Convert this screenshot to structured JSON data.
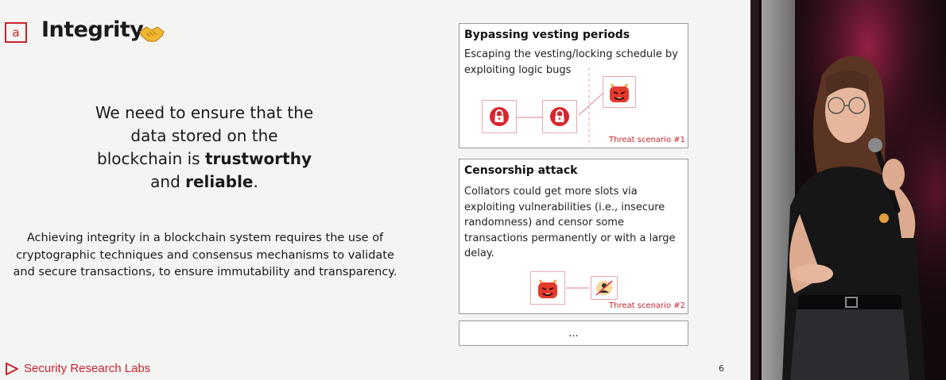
{
  "slide": {
    "badge": "a",
    "title": "Integrity",
    "headline_line1": "We need to ensure that the",
    "headline_line2": "data stored on the",
    "headline_line3_pre": "blockchain is ",
    "headline_line3_bold": "trustworthy",
    "headline_line4_pre": "and ",
    "headline_line4_bold": "reliable",
    "headline_line4_post": ".",
    "body": "Achieving integrity in a blockchain system requires the use of cryptographic techniques and consensus mechanisms to validate and secure transactions, to ensure immutability and transparency.",
    "footer_brand": "Security Research Labs",
    "page_number": "6",
    "cards": [
      {
        "title": "Bypassing vesting periods",
        "description_line1": "Escaping the vesting/locking schedule by",
        "description_line2": "exploiting logic bugs",
        "scenario": "Threat scenario #1"
      },
      {
        "title": "Censorship attack",
        "description_line1": "Collators could get more slots via",
        "description_line2": "exploiting vulnerabilities (i.e., insecure",
        "description_line3": "randomness) and censor some",
        "description_line4": "transactions permanently or with a large",
        "description_line5": "delay.",
        "scenario": "Threat scenario #2"
      },
      {
        "title": "..."
      }
    ]
  },
  "colors": {
    "brand_red": "#c8242f",
    "slide_bg": "#f4f4f2",
    "icon_border": "#e8a9ad"
  },
  "icons": [
    "handshake-emoji",
    "lock-icon",
    "devil-emoji",
    "censored-person-icon",
    "srlabs-logo"
  ]
}
